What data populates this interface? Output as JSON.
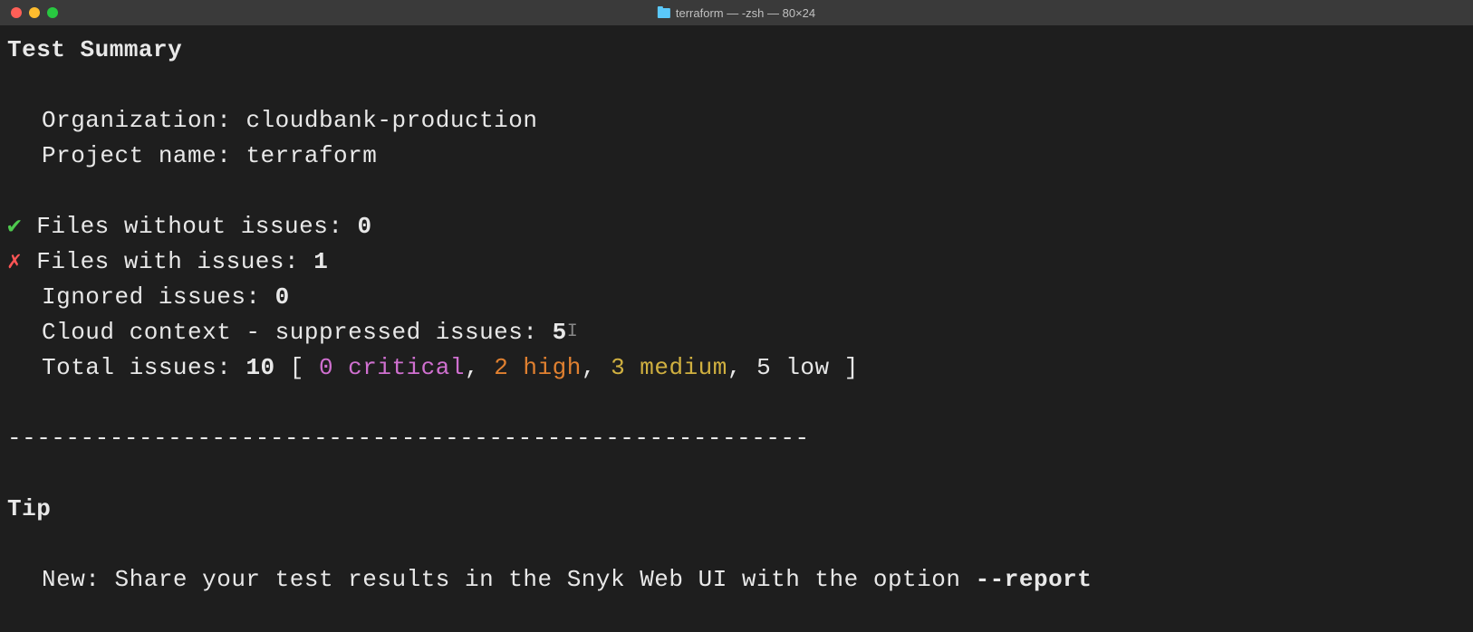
{
  "titlebar": {
    "title": "terraform — -zsh — 80×24"
  },
  "summary": {
    "heading": "Test Summary",
    "organization_label": "Organization: ",
    "organization_value": "cloudbank-production",
    "project_label": "Project name: ",
    "project_value": "terraform",
    "files_without_issues_label": "Files without issues: ",
    "files_without_issues_value": "0",
    "files_with_issues_label": "Files with issues: ",
    "files_with_issues_value": "1",
    "ignored_label": "Ignored issues: ",
    "ignored_value": "0",
    "suppressed_label": "Cloud context - suppressed issues: ",
    "suppressed_value": "5",
    "total_label": "Total issues: ",
    "total_value": "10",
    "bracket_open": " [ ",
    "critical": "0 critical",
    "sep1": ", ",
    "high": "2 high",
    "sep2": ", ",
    "medium": "3 medium",
    "sep3": ", ",
    "low": "5 low",
    "bracket_close": " ]",
    "divider": "-------------------------------------------------------",
    "check": "✔",
    "x": "✗"
  },
  "tip": {
    "heading": "Tip",
    "text_prefix": "New: Share your test results in the Snyk Web UI with the option ",
    "flag": "--report"
  }
}
